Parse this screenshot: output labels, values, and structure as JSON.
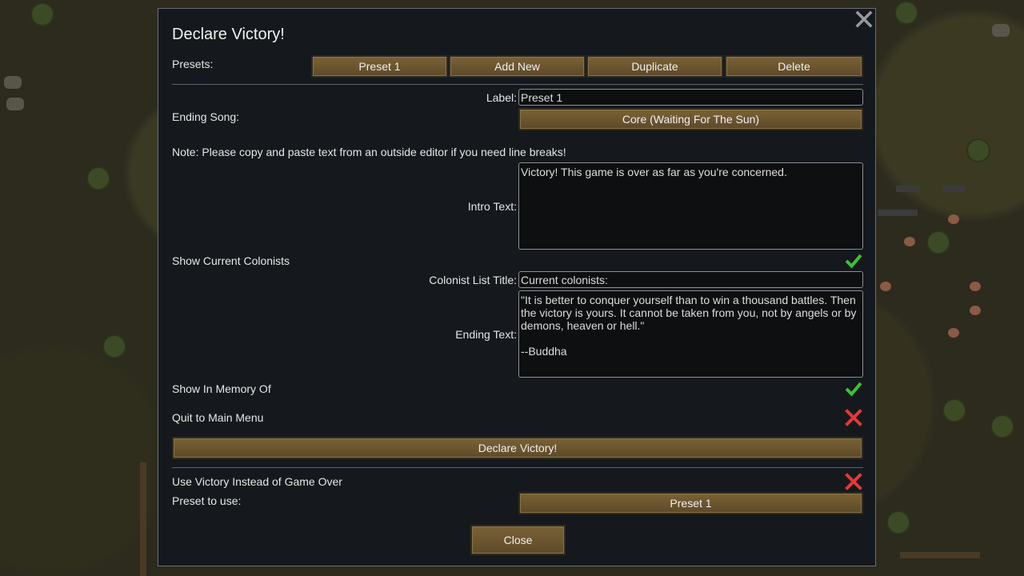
{
  "dialog": {
    "title": "Declare Victory!",
    "presets_label": "Presets:",
    "preset_buttons": [
      "Preset 1",
      "Add New",
      "Duplicate",
      "Delete"
    ],
    "label_label": "Label:",
    "label_value": "Preset 1",
    "ending_song_label": "Ending Song:",
    "ending_song_value": "Core (Waiting For The Sun)",
    "note": "Note: Please copy and paste text from an outside editor if you need line breaks!",
    "intro_text_label": "Intro Text:",
    "intro_text_value": "Victory! This game is over as far as you're concerned.",
    "show_current_colonists_label": "Show Current Colonists",
    "show_current_colonists": true,
    "colonist_list_title_label": "Colonist List Title:",
    "colonist_list_title_value": "Current colonists:",
    "ending_text_label": "Ending Text:",
    "ending_text_value": "\"It is better to conquer yourself than to win a thousand battles. Then the victory is yours. It cannot be taken from you, not by angels or by demons, heaven or hell.\"\n\n--Buddha",
    "show_in_memory_of_label": "Show In Memory Of",
    "show_in_memory_of": true,
    "quit_to_main_menu_label": "Quit to Main Menu",
    "quit_to_main_menu": false,
    "declare_victory_button": "Declare Victory!",
    "use_victory_label": "Use Victory Instead of Game Over",
    "use_victory": false,
    "preset_to_use_label": "Preset to use:",
    "preset_to_use_value": "Preset 1",
    "close_button": "Close"
  },
  "icons": {
    "close": "close-x-icon",
    "check": "green-checkmark-icon",
    "cross": "red-x-icon"
  },
  "colors": {
    "button": "#6b5530",
    "check": "#3cc13c",
    "cross": "#e03a3a",
    "dialog_bg": "#15191d"
  }
}
